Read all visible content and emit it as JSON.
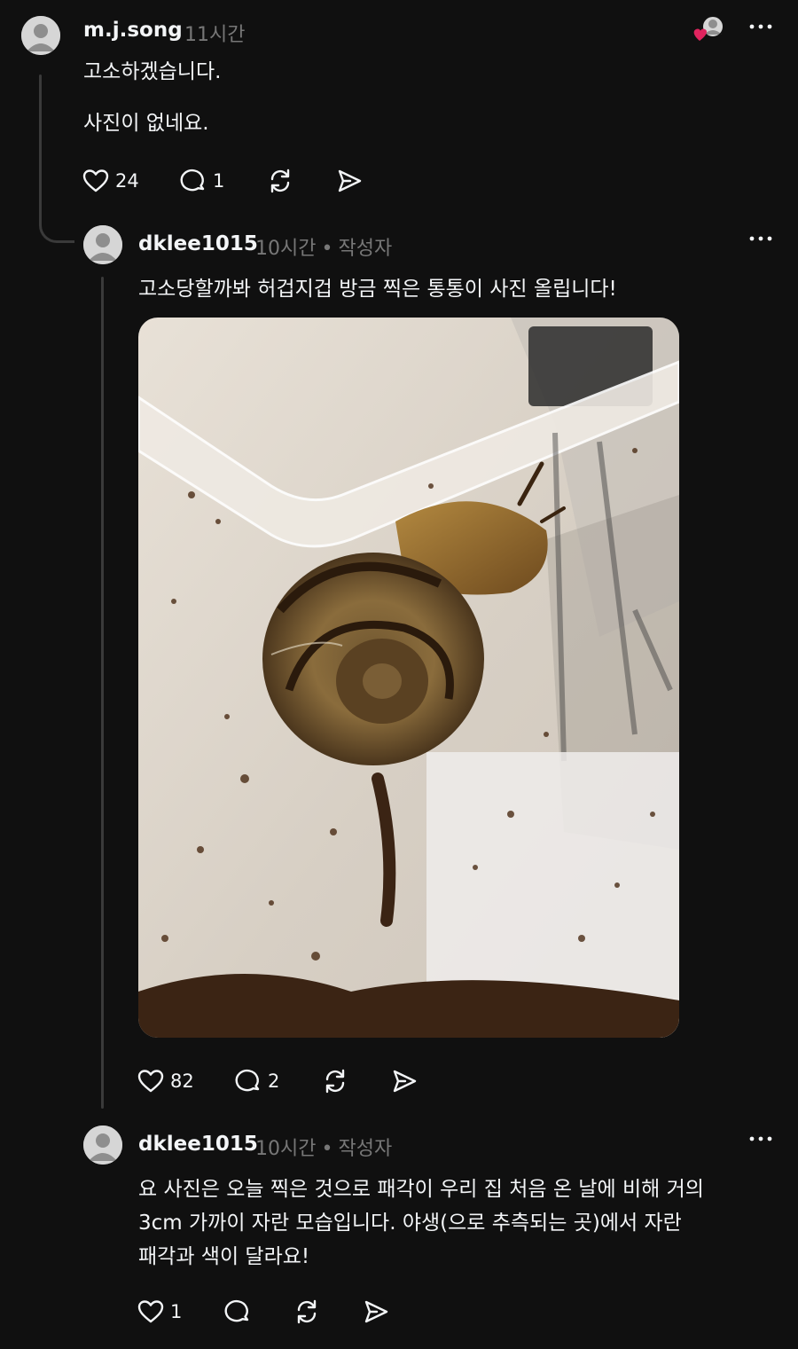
{
  "colors": {
    "background": "#101010",
    "text": "#f3f5f7",
    "muted": "#777777",
    "line": "#3a3a3a",
    "heart_badge": "#e0245e"
  },
  "posts": [
    {
      "username": "m.j.song",
      "time": "11시간",
      "lines": [
        "고소하겠습니다.",
        "사진이 없네요."
      ],
      "actions": {
        "likes": "24",
        "replies": "1"
      }
    },
    {
      "username": "dklee1015",
      "time": "10시간",
      "separator": "•",
      "author_tag": "작성자",
      "lines": [
        "고소당할까봐 허겁지겁 방금 찍은 통통이 사진 올립니다!"
      ],
      "image_icon": "snail-photo",
      "actions": {
        "likes": "82",
        "replies": "2"
      }
    },
    {
      "username": "dklee1015",
      "time": "10시간",
      "separator": "•",
      "author_tag": "작성자",
      "lines": [
        "요 사진은 오늘 찍은 것으로 패각이 우리 집 처음 온 날에 비해 거의",
        "3cm 가까이 자란 모습입니다. 야생(으로 추측되는 곳)에서 자란",
        "패각과 색이 달라요!"
      ],
      "actions": {
        "likes": "1"
      }
    }
  ],
  "icons": [
    "heart-icon",
    "comment-icon",
    "repost-icon",
    "share-icon",
    "more-icon",
    "liked-by-avatar-icon"
  ]
}
